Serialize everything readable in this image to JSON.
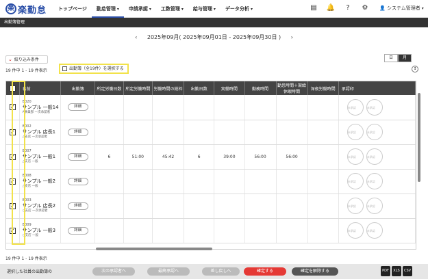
{
  "nav": {
    "logo_mark": "楽",
    "logo_text": "楽勤怠",
    "menu": [
      {
        "label": "トップページ",
        "caret": ""
      },
      {
        "label": "勤怠管理",
        "caret": "▾"
      },
      {
        "label": "申請承認",
        "caret": "▾"
      },
      {
        "label": "工数管理",
        "caret": "▾"
      },
      {
        "label": "給与管理",
        "caret": "▾"
      },
      {
        "label": "データ分析",
        "caret": "▾"
      }
    ],
    "icons": [
      "document-icon",
      "bell-icon",
      "help-icon",
      "gear-icon"
    ],
    "user": "システム管理者"
  },
  "subbar": {
    "title": "出勤簿管理"
  },
  "period": {
    "prev": "‹",
    "label": "2025年09月( 2025年09月01日 - 2025年09月30日 )",
    "next": "›"
  },
  "filter": {
    "label": "絞り込み条件"
  },
  "view": {
    "day": "日",
    "month": "月"
  },
  "count_top": "19 件中 1 - 19 件表示",
  "count_bottom": "19 件中 1 - 19 件表示",
  "select_all": "出勤簿（全19件）を選択する",
  "table": {
    "headers": [
      "名前",
      "出勤簿",
      "所定労働日数",
      "所定労働時間",
      "労働時間の総枠",
      "出勤日数",
      "実働時間",
      "勤務時間",
      "勤怠時間＋架給休暇時間",
      "深夜労働時間",
      "承認印"
    ],
    "detail_label": "詳細",
    "stamp_label": "未承認",
    "rows": [
      {
        "id": "B020",
        "name": "サンプル 一般14",
        "dept": "A事業部 一次承認者",
        "v": [
          "",
          "",
          "",
          "",
          "",
          "",
          "",
          ""
        ]
      },
      {
        "id": "B002",
        "name": "サンプル 店長1",
        "dept": "△支店 一次承認者",
        "v": [
          "",
          "",
          "",
          "",
          "",
          "",
          "",
          ""
        ]
      },
      {
        "id": "B007",
        "name": "サンプル 一般1",
        "dept": "△支店 一般",
        "v": [
          "6",
          "51:00",
          "45:42",
          "6",
          "39:00",
          "56:00",
          "56:00",
          ""
        ]
      },
      {
        "id": "B008",
        "name": "サンプル 一般2",
        "dept": "△支店 一般",
        "v": [
          "",
          "",
          "",
          "",
          "",
          "",
          "",
          ""
        ]
      },
      {
        "id": "B003",
        "name": "サンプル 店長2",
        "dept": "○支店 一次承認者",
        "v": [
          "",
          "",
          "",
          "",
          "",
          "",
          "",
          ""
        ]
      },
      {
        "id": "B009",
        "name": "サンプル 一般3",
        "dept": "○支店 一般",
        "v": [
          "",
          "",
          "",
          "",
          "",
          "",
          "",
          ""
        ]
      }
    ]
  },
  "footer": {
    "label": "選択した社員の出勤簿の",
    "buttons": [
      "次の承認者へ",
      "最終承認へ",
      "差し戻しへ",
      "確定する",
      "確定を解除する"
    ],
    "export": [
      "PDF",
      "XLS",
      "CSV"
    ]
  },
  "colors": {
    "brand": "#2b4fa8",
    "highlight": "#f2e24a",
    "confirm": "#e53935"
  }
}
